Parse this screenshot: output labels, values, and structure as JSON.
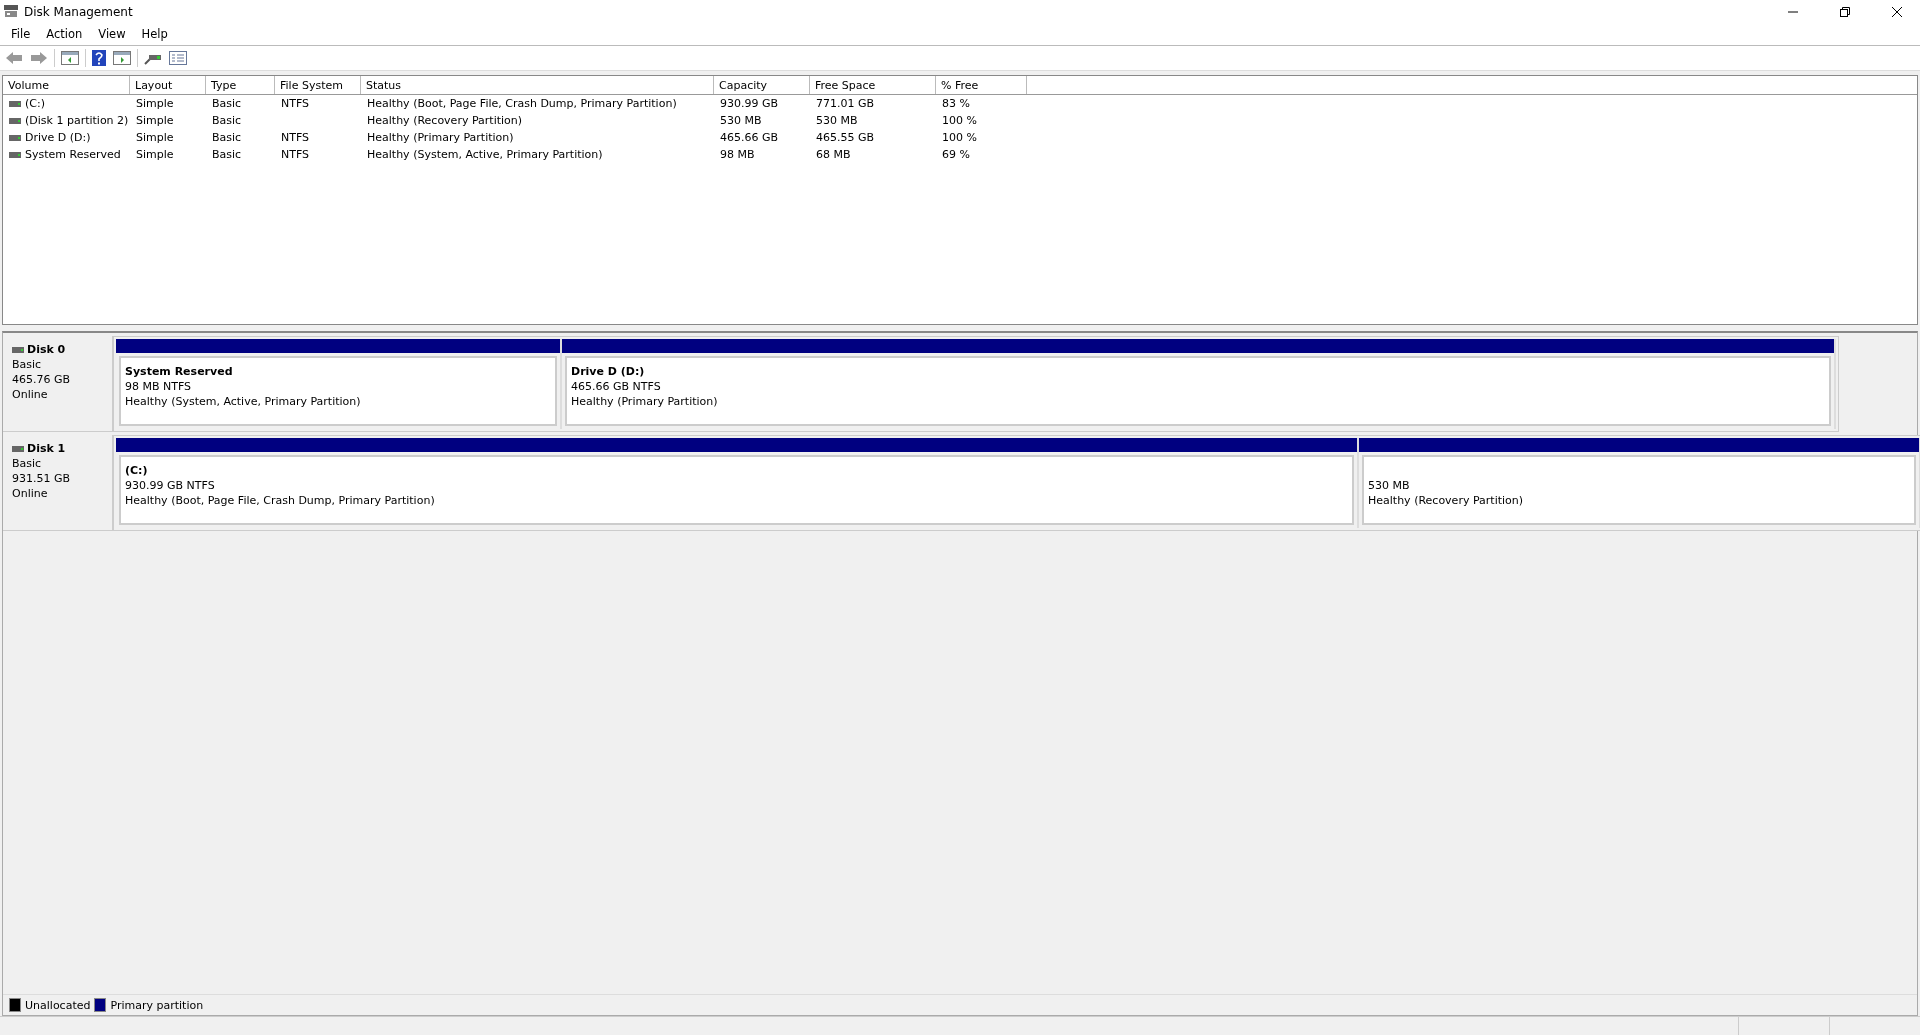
{
  "window": {
    "title": "Disk Management"
  },
  "menu": [
    "File",
    "Action",
    "View",
    "Help"
  ],
  "volumes": {
    "columns": [
      "Volume",
      "Layout",
      "Type",
      "File System",
      "Status",
      "Capacity",
      "Free Space",
      "% Free"
    ],
    "rows": [
      [
        "(C:)",
        "Simple",
        "Basic",
        "NTFS",
        "Healthy (Boot, Page File, Crash Dump, Primary Partition)",
        "930.99 GB",
        "771.01 GB",
        "83 %"
      ],
      [
        "(Disk 1 partition 2)",
        "Simple",
        "Basic",
        "",
        "Healthy (Recovery Partition)",
        "530 MB",
        "530 MB",
        "100 %"
      ],
      [
        "Drive D (D:)",
        "Simple",
        "Basic",
        "NTFS",
        "Healthy (Primary Partition)",
        "465.66 GB",
        "465.55 GB",
        "100 %"
      ],
      [
        "System Reserved",
        "Simple",
        "Basic",
        "NTFS",
        "Healthy (System, Active, Primary Partition)",
        "98 MB",
        "68 MB",
        "69 %"
      ]
    ]
  },
  "disks": [
    {
      "name": "Disk 0",
      "type": "Basic",
      "size": "465.76 GB",
      "state": "Online",
      "partitions": [
        {
          "name": "System Reserved",
          "size": "98 MB NTFS",
          "status": "Healthy (System, Active, Primary Partition)",
          "color": "#000080"
        },
        {
          "name": "Drive D  (D:)",
          "size": "465.66 GB NTFS",
          "status": "Healthy (Primary Partition)",
          "color": "#000080"
        }
      ]
    },
    {
      "name": "Disk 1",
      "type": "Basic",
      "size": "931.51 GB",
      "state": "Online",
      "partitions": [
        {
          "name": "(C:)",
          "size": "930.99 GB NTFS",
          "status": "Healthy (Boot, Page File, Crash Dump, Primary Partition)",
          "color": "#000080"
        },
        {
          "size": "530 MB",
          "status": "Healthy (Recovery Partition)",
          "color": "#000080"
        }
      ]
    }
  ],
  "legend": [
    {
      "label": "Unallocated",
      "color": "#000000"
    },
    {
      "label": "Primary partition",
      "color": "#000080"
    }
  ]
}
